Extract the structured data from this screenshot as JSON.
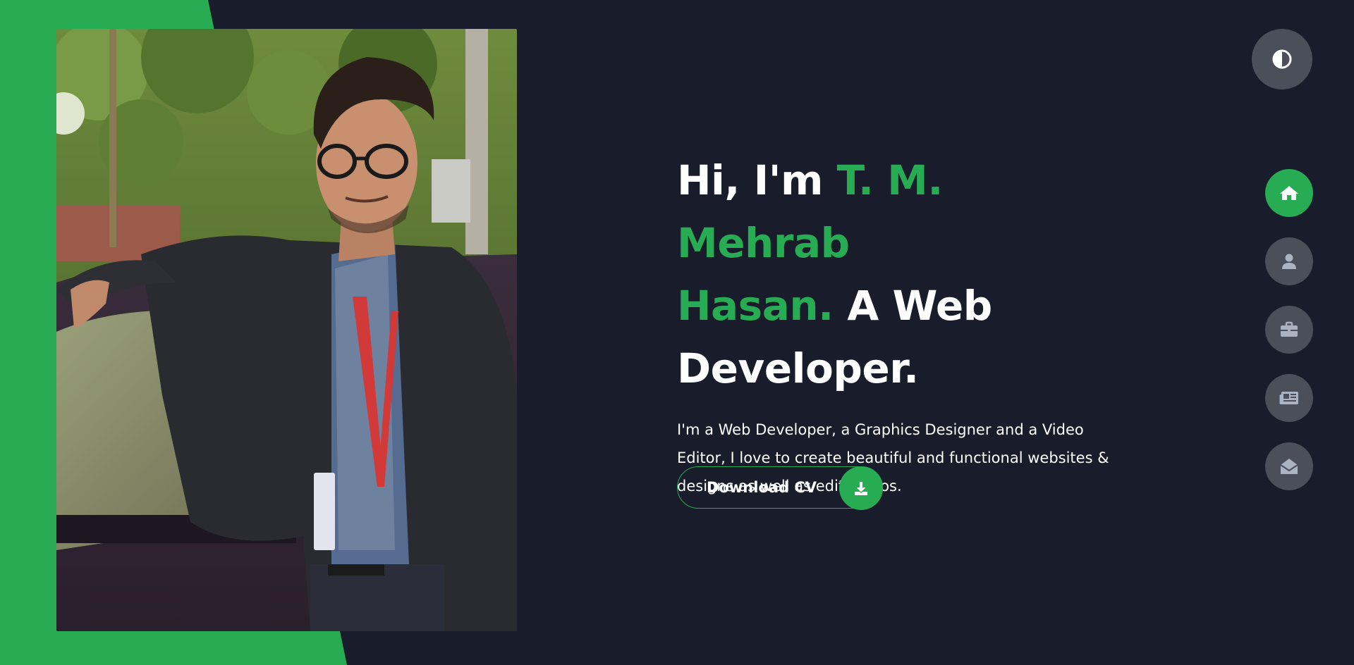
{
  "hero": {
    "greeting": "Hi, I'm ",
    "name_line1": "T. M. Mehrab",
    "name_line2": "Hasan.",
    "role_rest": " A Web",
    "role_line3": "Developer.",
    "description": "I'm a Web Developer, a Graphics Designer and a Video Editor, I love to create beautiful and functional websites & designs as well as edit videos."
  },
  "cta": {
    "download_label": "Download CV",
    "icon": "download-icon"
  },
  "theme_toggle": {
    "icon": "contrast-icon"
  },
  "nav": {
    "items": [
      {
        "name": "home",
        "icon": "home-icon",
        "active": true
      },
      {
        "name": "about",
        "icon": "user-icon",
        "active": false
      },
      {
        "name": "portfolio",
        "icon": "briefcase-icon",
        "active": false
      },
      {
        "name": "blog",
        "icon": "newspaper-icon",
        "active": false
      },
      {
        "name": "contact",
        "icon": "envelope-open-icon",
        "active": false
      }
    ]
  },
  "colors": {
    "background": "#191c2b",
    "accent": "#27ab53",
    "button_gray": "#4a4f5a",
    "text": "#ffffff"
  }
}
